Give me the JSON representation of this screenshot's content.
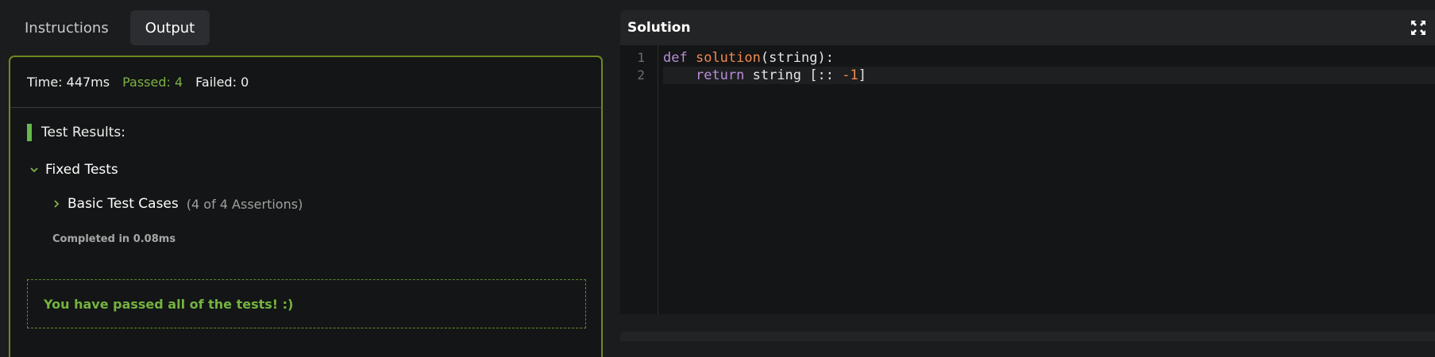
{
  "tabs": [
    {
      "label": "Instructions",
      "active": false
    },
    {
      "label": "Output",
      "active": true
    }
  ],
  "output": {
    "time_label": "Time: 447ms",
    "passed_label": "Passed: 4",
    "failed_label": "Failed: 0",
    "results_heading": "Test Results:",
    "fixed_tests_label": "Fixed Tests",
    "basic_test_label": "Basic Test Cases",
    "basic_test_count": "(4 of 4 Assertions)",
    "completed_label": "Completed in 0.08ms",
    "pass_message": "You have passed all of the tests! :)"
  },
  "solution": {
    "title": "Solution",
    "line_numbers": [
      "1",
      "2"
    ],
    "code": {
      "l1_kw": "def",
      "l1_fn": "solution",
      "l1_rest": "(string):",
      "l2_indent": "    ",
      "l2_kw": "return",
      "l2_mid": " string [:: ",
      "l2_num": "-1",
      "l2_end": "]"
    }
  },
  "colors": {
    "accent_green": "#7cb342",
    "border_olive": "#6d8a1f",
    "keyword_purple": "#b68fd9",
    "function_orange": "#f08a50"
  }
}
